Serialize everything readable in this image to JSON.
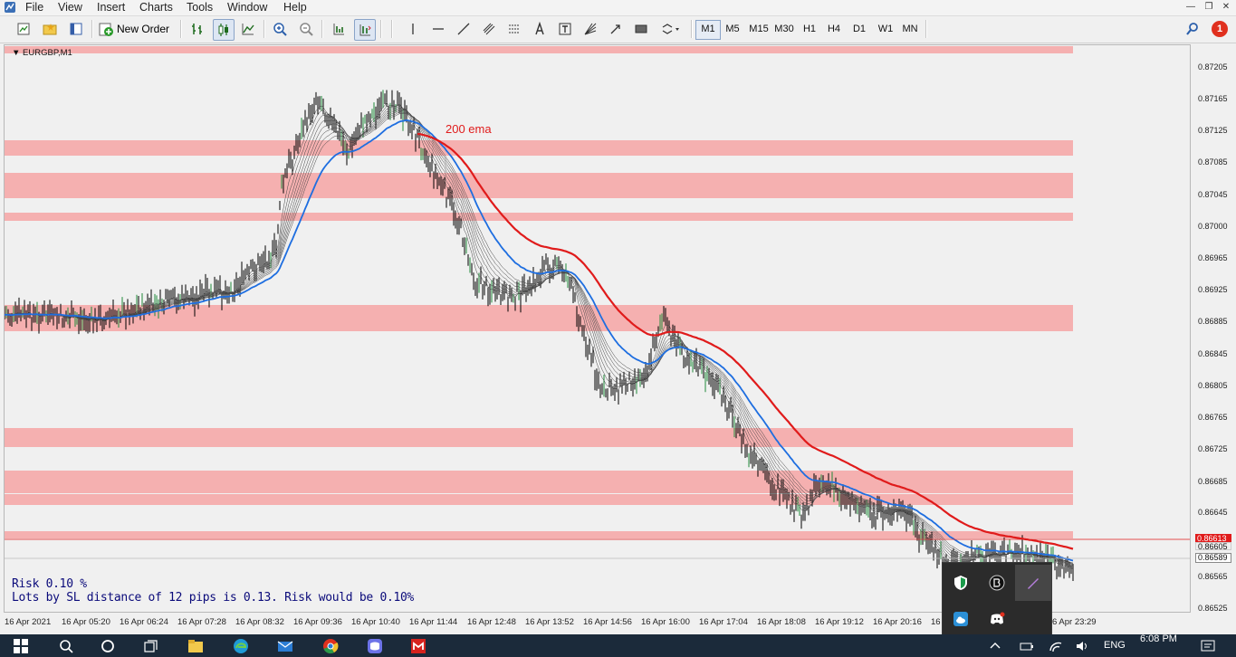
{
  "menu": [
    "File",
    "View",
    "Insert",
    "Charts",
    "Tools",
    "Window",
    "Help"
  ],
  "toolbar": {
    "new_order_label": "New Order",
    "timeframes": [
      "M1",
      "M5",
      "M15",
      "M30",
      "H1",
      "H4",
      "D1",
      "W1",
      "MN"
    ],
    "active_timeframe": "M1",
    "notification_count": "1"
  },
  "chart": {
    "symbol": "EURGBP,M1",
    "annotation": "200 ema",
    "risk_line1": "Risk 0.10 %",
    "risk_line2": "Lots by SL distance of 12 pips is 0.13. Risk would be 0.10%",
    "current_price_tag": "0.86613",
    "bid_tag": "0.86589",
    "ask_tag": "0.86605"
  },
  "price_axis": [
    "0.87205",
    "0.87165",
    "0.87125",
    "0.87085",
    "0.87045",
    "0.87000",
    "0.86965",
    "0.86925",
    "0.86885",
    "0.86845",
    "0.86805",
    "0.86765",
    "0.86725",
    "0.86685",
    "0.86645",
    "0.86565",
    "0.86525"
  ],
  "time_axis": [
    "16 Apr 2021",
    "16 Apr 05:20",
    "16 Apr 06:24",
    "16 Apr 07:28",
    "16 Apr 08:32",
    "16 Apr 09:36",
    "16 Apr 10:40",
    "16 Apr 11:44",
    "16 Apr 12:48",
    "16 Apr 13:52",
    "16 Apr 14:56",
    "16 Apr 16:00",
    "16 Apr 17:04",
    "16 Apr 18:08",
    "16 Apr 19:12",
    "16 Apr 20:16",
    "16",
    "6 Apr 23:29"
  ],
  "taskbar": {
    "language": "ENG",
    "clock": "6:08 PM"
  },
  "colors": {
    "zone": "#f5b0b0",
    "ema200": "#e01b1b",
    "ema_fast": "#1e6ee0",
    "candles": "#000000"
  }
}
